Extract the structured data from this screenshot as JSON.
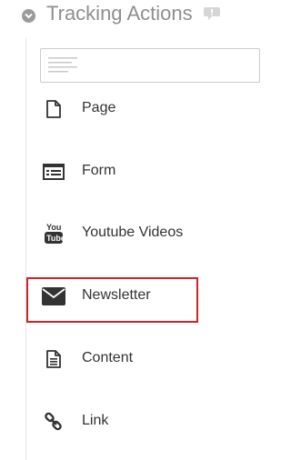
{
  "header": {
    "title": "Tracking Actions",
    "icons": {
      "collapse": "chevron-down-icon",
      "help": "speech-bubble-icon"
    }
  },
  "search": {
    "value": "",
    "placeholder": "",
    "icon": "list-lines-icon"
  },
  "actions": [
    {
      "label": "Page",
      "icon": "page-icon"
    },
    {
      "label": "Form",
      "icon": "form-icon"
    },
    {
      "label": "Youtube Videos",
      "icon": "youtube-icon"
    },
    {
      "label": "Newsletter",
      "icon": "envelope-icon",
      "highlighted": true
    },
    {
      "label": "Content",
      "icon": "document-icon"
    },
    {
      "label": "Link",
      "icon": "link-icon"
    }
  ],
  "colors": {
    "highlight": "#d0202a",
    "icon": "#333333",
    "title": "#8f8f8f"
  }
}
